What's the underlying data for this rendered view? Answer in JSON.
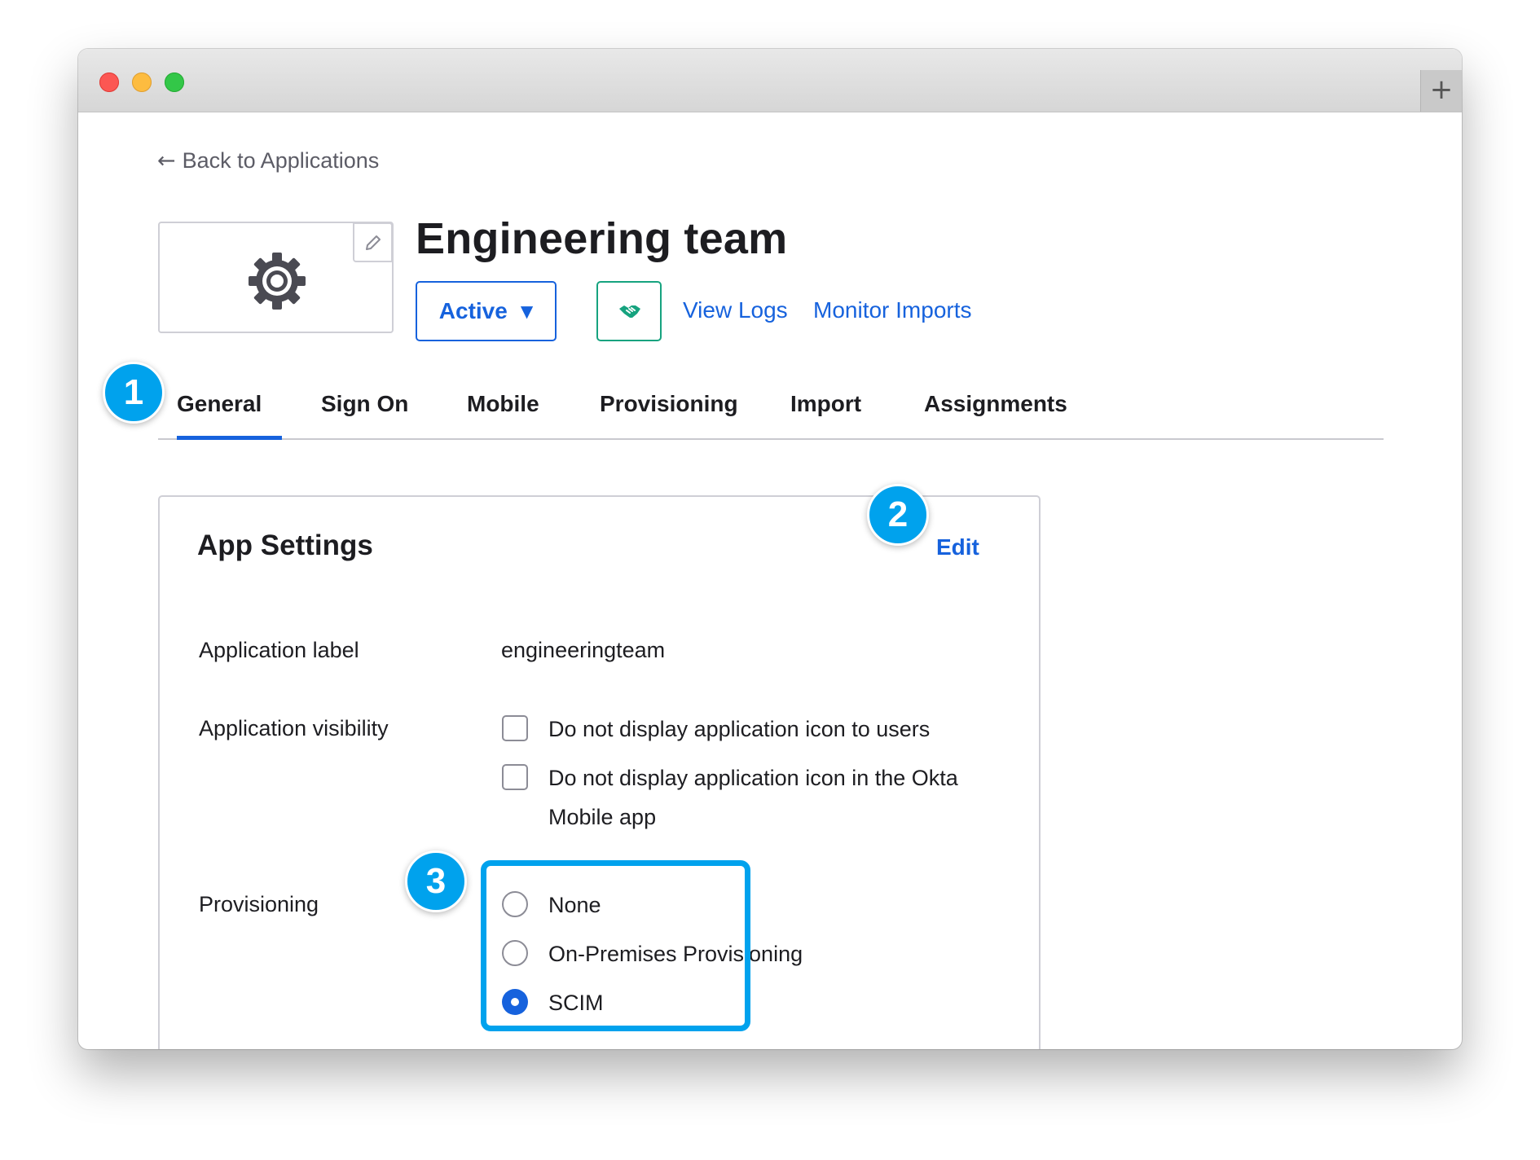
{
  "window": {
    "new_tab_icon": "plus-icon",
    "new_tab_glyph": "+"
  },
  "nav": {
    "back_arrow": "←",
    "back_label": "Back to Applications"
  },
  "app": {
    "title": "Engineering team",
    "logo_icon": "gear-icon",
    "status_label": "Active",
    "status_caret": "▼",
    "push_groups_icon": "handshake-icon",
    "view_logs_label": "View Logs",
    "monitor_imports_label": "Monitor Imports"
  },
  "tabs": [
    {
      "label": "General",
      "active": true
    },
    {
      "label": "Sign On"
    },
    {
      "label": "Mobile"
    },
    {
      "label": "Provisioning"
    },
    {
      "label": "Import"
    },
    {
      "label": "Assignments"
    }
  ],
  "callouts": [
    "1",
    "2",
    "3"
  ],
  "settings": {
    "title": "App Settings",
    "edit_label": "Edit",
    "app_label": {
      "label": "Application label",
      "value": "engineeringteam"
    },
    "visibility": {
      "label": "Application visibility",
      "options": [
        {
          "text": "Do not display application icon to users",
          "checked": false
        },
        {
          "text": "Do not display application icon in the Okta Mobile app",
          "checked": false
        }
      ]
    },
    "provisioning": {
      "label": "Provisioning",
      "options": [
        {
          "text": "None",
          "selected": false
        },
        {
          "text": "On-Premises Provisioning",
          "selected": false
        },
        {
          "text": "SCIM",
          "selected": true
        }
      ]
    }
  },
  "colors": {
    "accent": "#1662dd",
    "callout": "#00a2ed",
    "success": "#16a37f"
  }
}
